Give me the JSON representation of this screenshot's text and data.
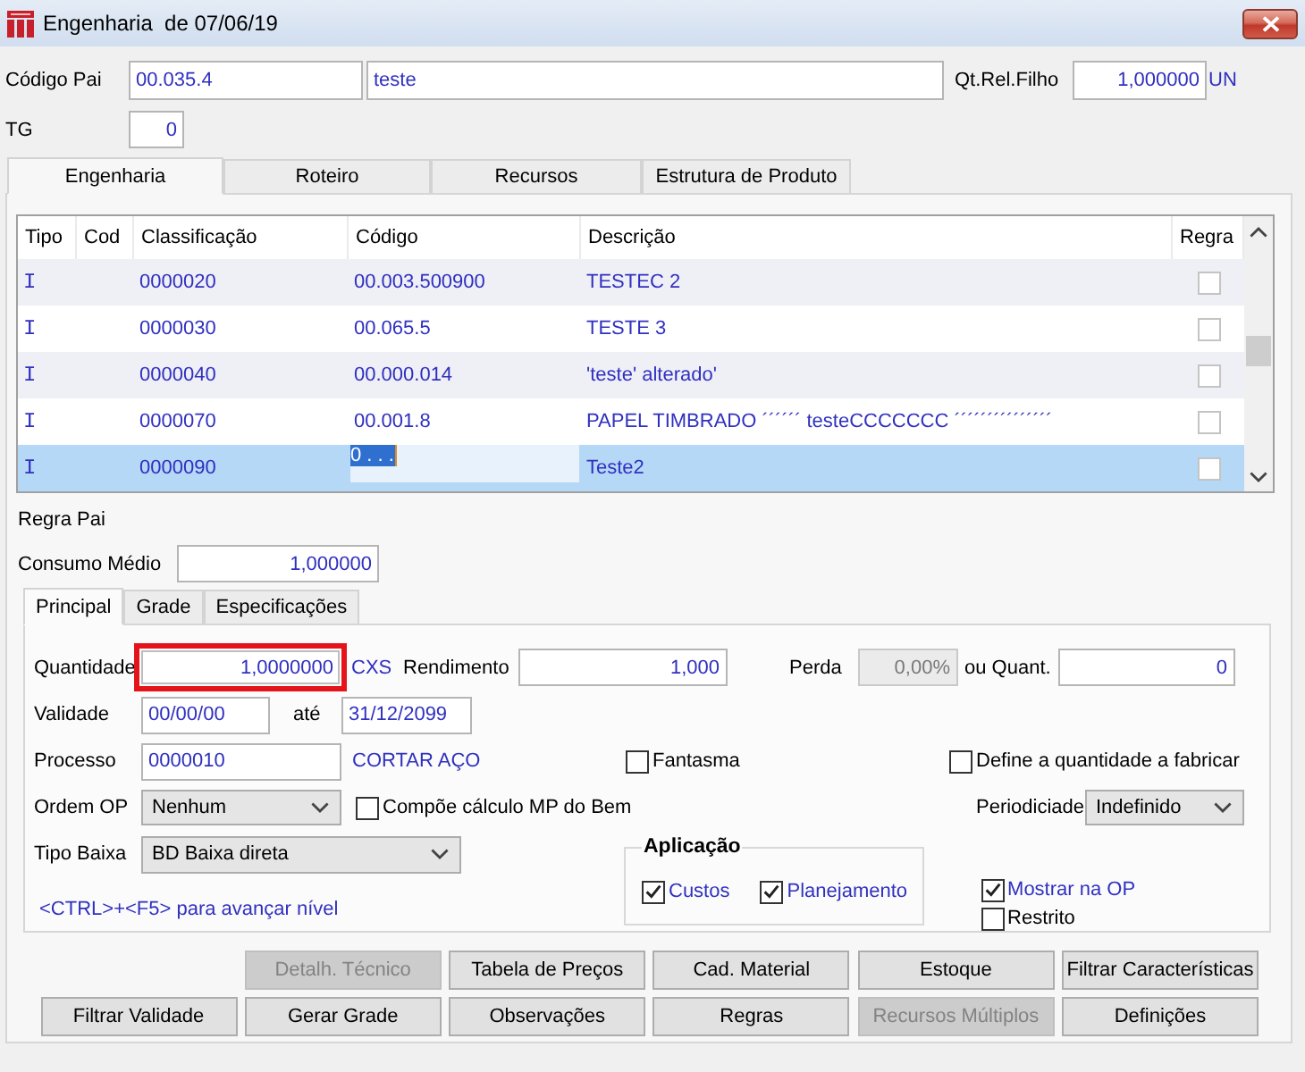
{
  "window": {
    "title": "Engenharia  de 07/06/19"
  },
  "header": {
    "parent_code": {
      "label": "Código Pai",
      "code": "00.035.4",
      "description": "teste"
    },
    "qt_rel_filho": {
      "label": "Qt.Rel.Filho",
      "value": "1,000000",
      "unit": "UN"
    },
    "tg": {
      "label": "TG",
      "value": "0"
    }
  },
  "tabs": [
    {
      "label": "Engenharia",
      "selected": true
    },
    {
      "label": "Roteiro",
      "selected": false
    },
    {
      "label": "Recursos",
      "selected": false
    },
    {
      "label": "Estrutura de Produto",
      "selected": false
    }
  ],
  "grid": {
    "columns": [
      "Tipo",
      "Cod",
      "Classificação",
      "Código",
      "Descrição",
      "Regra"
    ],
    "rows": [
      {
        "tipo": "I",
        "classificacao": "0000020",
        "codigo": "00.003.500900",
        "descricao": "TESTEC 2",
        "regra": false,
        "selected": false,
        "editing": false
      },
      {
        "tipo": "I",
        "classificacao": "0000030",
        "codigo": "00.065.5",
        "descricao": "TESTE 3",
        "regra": false,
        "selected": false,
        "editing": false
      },
      {
        "tipo": "I",
        "classificacao": "0000040",
        "codigo": "00.000.014",
        "descricao": "'teste' alterado'",
        "regra": false,
        "selected": false,
        "editing": false
      },
      {
        "tipo": "I",
        "classificacao": "0000070",
        "codigo": "00.001.8",
        "descricao": "PAPEL TIMBRADO ´´´´´´ testeCCCCCCC ´´´´´´´´´´´´´´´",
        "regra": false,
        "selected": false,
        "editing": false
      },
      {
        "tipo": "I",
        "classificacao": "0000090",
        "codigo": "0 . . .",
        "descricao": "Teste2",
        "regra": false,
        "selected": true,
        "editing": true
      }
    ]
  },
  "regra_pai": {
    "label": "Regra Pai"
  },
  "consumo_medio": {
    "label": "Consumo Médio",
    "value": "1,000000"
  },
  "subtabs": [
    {
      "label": "Principal",
      "selected": true
    },
    {
      "label": "Grade",
      "selected": false
    },
    {
      "label": "Especificações",
      "selected": false
    }
  ],
  "principal": {
    "quantidade": {
      "label": "Quantidade",
      "value": "1,0000000",
      "unit": "CXS",
      "highlighted": true
    },
    "rendimento": {
      "label": "Rendimento",
      "value": "1,000"
    },
    "perda": {
      "label": "Perda",
      "value": "0,00%",
      "disabled": true
    },
    "ou_quant": {
      "label": "ou Quant.",
      "value": "0"
    },
    "validade": {
      "label": "Validade",
      "from": "00/00/00",
      "to_label": "até",
      "to": "31/12/2099"
    },
    "processo": {
      "label": "Processo",
      "value": "0000010",
      "description": "CORTAR AÇO"
    },
    "fantasma": {
      "label": "Fantasma",
      "checked": false
    },
    "define_quantidade": {
      "label": "Define a quantidade a fabricar",
      "checked": false
    },
    "ordem_op": {
      "label": "Ordem OP",
      "value": "Nenhum"
    },
    "compoe_calculo": {
      "label": "Compõe cálculo MP do Bem",
      "checked": false
    },
    "periodicidade": {
      "label": "Periodiciade",
      "value": "Indefinido"
    },
    "tipo_baixa": {
      "label": "Tipo Baixa",
      "value": "BD Baixa direta"
    },
    "aplicacao": {
      "title": "Aplicação",
      "options": [
        {
          "label": "Custos",
          "checked": true
        },
        {
          "label": "Planejamento",
          "checked": true
        }
      ]
    },
    "mostrar_na_op": {
      "label": "Mostrar na OP",
      "checked": true
    },
    "restrito": {
      "label": "Restrito",
      "checked": false
    },
    "hint": "<CTRL>+<F5> para avançar nível"
  },
  "buttons": [
    [
      {
        "label": "Detalh. Técnico",
        "disabled": true
      },
      {
        "label": "Tabela de Preços",
        "disabled": false
      },
      {
        "label": "Cad. Material",
        "disabled": false
      },
      {
        "label": "Estoque",
        "disabled": false
      },
      {
        "label": "Filtrar Características",
        "disabled": false
      }
    ],
    [
      {
        "label": "Filtrar Validade",
        "disabled": false
      },
      {
        "label": "Gerar Grade",
        "disabled": false
      },
      {
        "label": "Observações",
        "disabled": false
      },
      {
        "label": "Regras",
        "disabled": false
      },
      {
        "label": "Recursos Múltiplos",
        "disabled": true
      },
      {
        "label": "Definições",
        "disabled": false
      }
    ]
  ]
}
